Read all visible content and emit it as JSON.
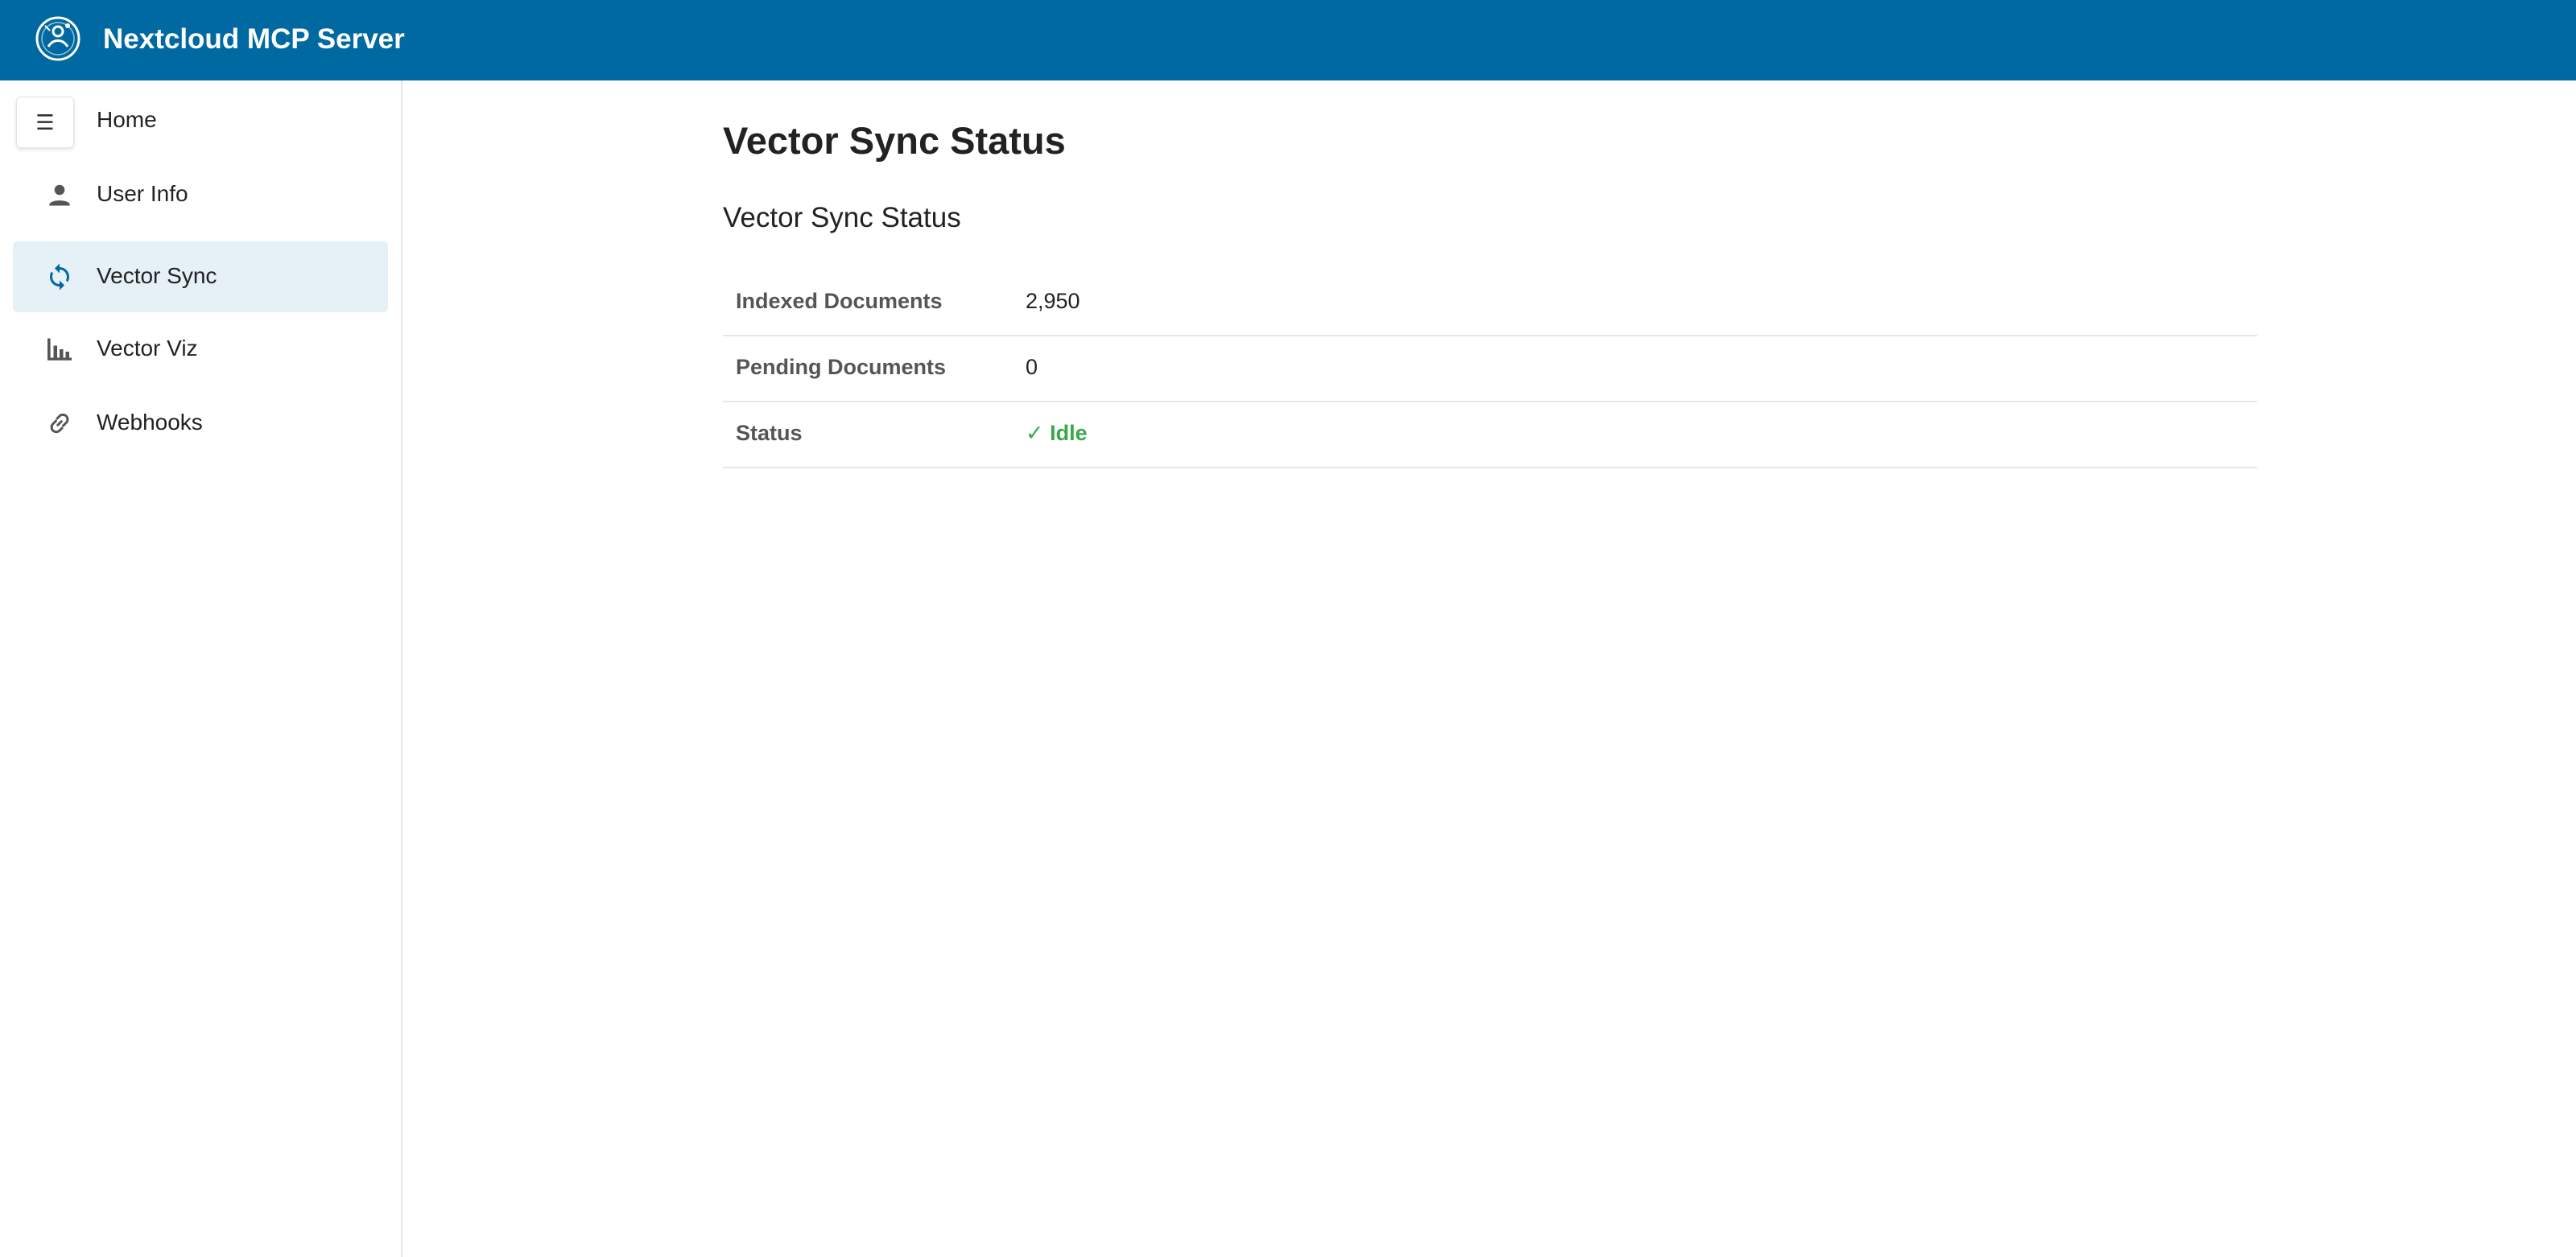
{
  "header": {
    "app_title": "Nextcloud MCP Server",
    "logo_icon": "nextcloud-logo-icon",
    "background": "#0069a2"
  },
  "sidebar": {
    "toggle_glyph": "☰",
    "items": [
      {
        "label": "Home",
        "icon": "none",
        "active": false
      },
      {
        "label": "User Info",
        "icon": "person-icon",
        "active": false
      },
      {
        "label": "Vector Sync",
        "icon": "sync-icon",
        "active": true
      },
      {
        "label": "Vector Viz",
        "icon": "bar-chart-icon",
        "active": false
      },
      {
        "label": "Webhooks",
        "icon": "link-icon",
        "active": false
      }
    ],
    "active_background": "#e6f0f7"
  },
  "main": {
    "page_title": "Vector Sync Status",
    "section_title": "Vector Sync Status",
    "rows": [
      {
        "label": "Indexed Documents",
        "value": "2,950"
      },
      {
        "label": "Pending Documents",
        "value": "0"
      },
      {
        "label": "Status",
        "value": "✓ Idle",
        "value_color": "#3aa84a"
      }
    ]
  }
}
